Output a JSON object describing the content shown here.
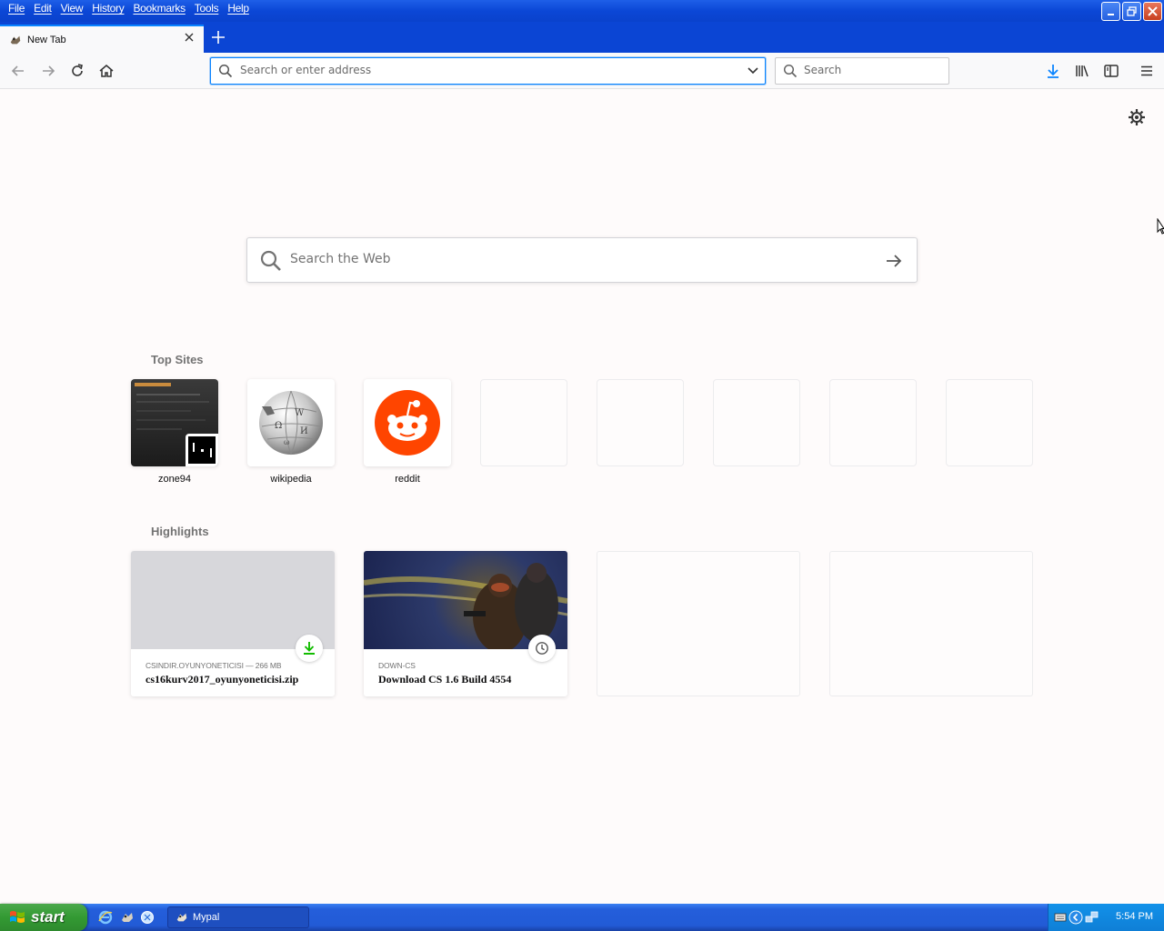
{
  "menu": [
    "File",
    "Edit",
    "View",
    "History",
    "Bookmarks",
    "Tools",
    "Help"
  ],
  "tab": {
    "title": "New Tab"
  },
  "urlbar": {
    "placeholder": "Search or enter address"
  },
  "searchbar": {
    "placeholder": "Search"
  },
  "web_search": {
    "placeholder": "Search the Web"
  },
  "top_sites": {
    "title": "Top Sites",
    "sites": [
      {
        "label": "zone94"
      },
      {
        "label": "wikipedia"
      },
      {
        "label": "reddit"
      }
    ]
  },
  "highlights": {
    "title": "Highlights",
    "cards": [
      {
        "source": "CSINDIR.OYUNYONETICISI — 266 MB",
        "title": "cs16kurv2017_oyunyoneticisi.zip",
        "badge_icon": "download-icon"
      },
      {
        "source": "DOWN-CS",
        "title": "Download CS 1.6 Build 4554",
        "badge_icon": "clock-icon"
      }
    ]
  },
  "taskbar": {
    "start_label": "start",
    "task_label": "Mypal",
    "clock": "5:54 PM"
  },
  "colors": {
    "accent": "#0a84ff",
    "reddit": "#ff4500",
    "download_green": "#12bc00",
    "xp_blue": "#0b47d6"
  }
}
